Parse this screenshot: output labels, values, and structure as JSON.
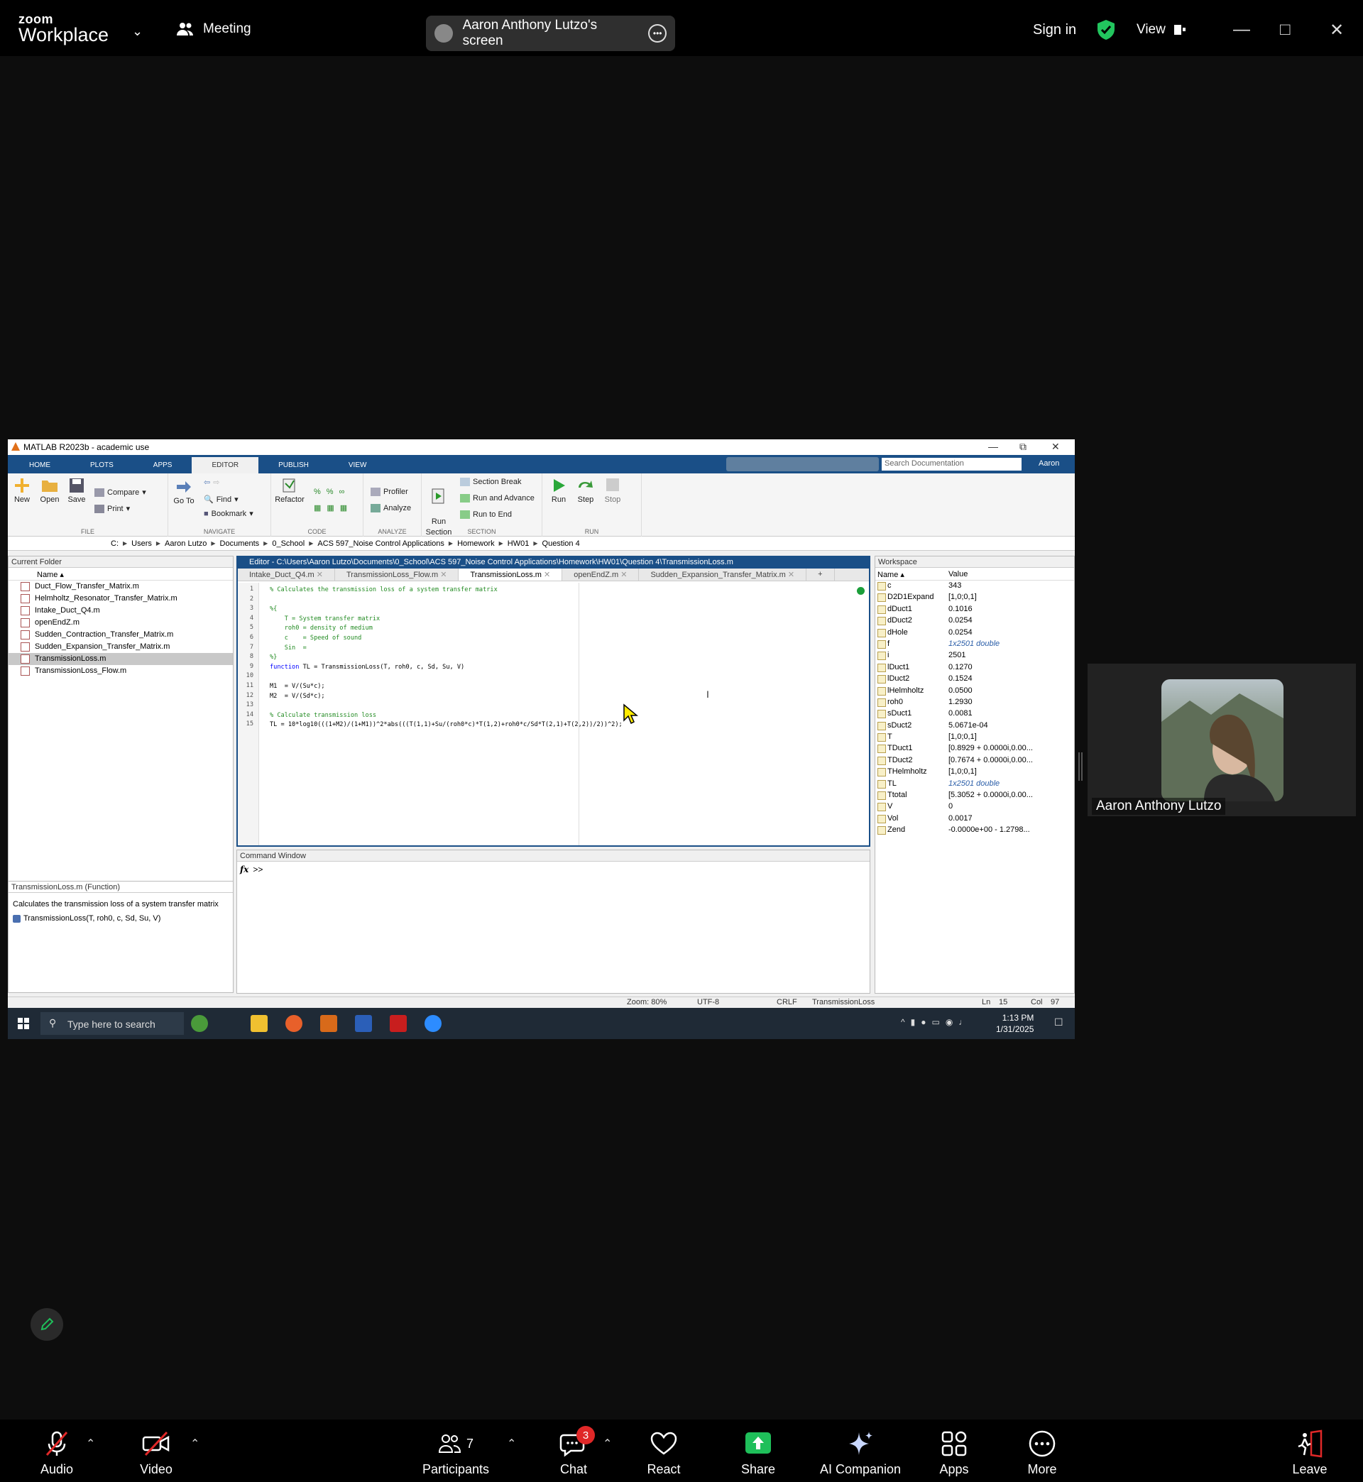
{
  "zoom": {
    "logo_small": "zoom",
    "logo_big": "Workplace",
    "meeting_label": "Meeting",
    "screen_label": "Aaron Anthony Lutzo's screen",
    "sign_in": "Sign in",
    "view_label": "View",
    "accent": "#0e72ed",
    "shield_color": "#22c55e"
  },
  "matlab": {
    "title": "MATLAB R2023b - academic use",
    "tabs": [
      "HOME",
      "PLOTS",
      "APPS",
      "EDITOR",
      "PUBLISH",
      "VIEW"
    ],
    "search_placeholder": "Search Documentation",
    "user": "Aaron",
    "ribbon": {
      "new": "New",
      "open": "Open",
      "save": "Save",
      "compare": "Compare",
      "print": "Print",
      "goto": "Go To",
      "find": "Find",
      "bookmark": "Bookmark",
      "refactor": "Refactor",
      "profiler": "Profiler",
      "analyze": "Analyze",
      "run_section": "Run\nSection",
      "section_break": "Section Break",
      "run_and_advance": "Run and Advance",
      "run_to_end": "Run to End",
      "run": "Run",
      "step": "Step",
      "stop": "Stop",
      "groups": [
        "FILE",
        "NAVIGATE",
        "CODE",
        "ANALYZE",
        "SECTION",
        "RUN"
      ]
    },
    "address": [
      "C:",
      "Users",
      "Aaron Lutzo",
      "Documents",
      "0_School",
      "ACS 597_Noise Control Applications",
      "Homework",
      "HW01",
      "Question 4"
    ],
    "current_folder": {
      "title": "Current Folder",
      "col_name": "Name",
      "files": [
        "Duct_Flow_Transfer_Matrix.m",
        "Helmholtz_Resonator_Transfer_Matrix.m",
        "Intake_Duct_Q4.m",
        "openEndZ.m",
        "Sudden_Contraction_Transfer_Matrix.m",
        "Sudden_Expansion_Transfer_Matrix.m",
        "TransmissionLoss.m",
        "TransmissionLoss_Flow.m"
      ],
      "selected_index": 6
    },
    "details": {
      "title": "TransmissionLoss.m  (Function)",
      "description": "Calculates the transmission loss of a system transfer matrix",
      "signature": "TransmissionLoss(T, roh0, c, Sd, Su, V)"
    },
    "editor": {
      "title": "Editor - C:\\Users\\Aaron Lutzo\\Documents\\0_School\\ACS 597_Noise Control Applications\\Homework\\HW01\\Question 4\\TransmissionLoss.m",
      "tabs": [
        "Intake_Duct_Q4.m",
        "TransmissionLoss_Flow.m",
        "TransmissionLoss.m",
        "openEndZ.m",
        "Sudden_Expansion_Transfer_Matrix.m",
        "+"
      ],
      "active_tab": 2,
      "lines": [
        {
          "n": "1",
          "t": "% Calculates the transmission loss of a system transfer matrix",
          "k": "com"
        },
        {
          "n": "2",
          "t": "",
          "k": "norm"
        },
        {
          "n": "3",
          "t": "%{",
          "k": "com"
        },
        {
          "n": "4",
          "t": "    T = System transfer matrix",
          "k": "com"
        },
        {
          "n": "5",
          "t": "    roh0 = density of medium",
          "k": "com"
        },
        {
          "n": "6",
          "t": "    c    = Speed of sound",
          "k": "com"
        },
        {
          "n": "7",
          "t": "    Sin  =",
          "k": "com"
        },
        {
          "n": "8",
          "t": "%}",
          "k": "com"
        },
        {
          "n": "9",
          "t": "function TL = TransmissionLoss(T, roh0, c, Sd, Su, V)",
          "k": "fn"
        },
        {
          "n": "10",
          "t": "",
          "k": "norm"
        },
        {
          "n": "11",
          "t": "M1  = V/(Su*c);",
          "k": "norm"
        },
        {
          "n": "12",
          "t": "M2  = V/(Sd*c);",
          "k": "norm"
        },
        {
          "n": "13",
          "t": "",
          "k": "norm"
        },
        {
          "n": "14",
          "t": "% Calculate transmission loss",
          "k": "com"
        },
        {
          "n": "15",
          "t": "TL = 10*log10(((1+M2)/(1+M1))^2*abs(((T(1,1)+Su/(roh0*c)*T(1,2)+roh0*c/Sd*T(2,1)+T(2,2))/2))^2);",
          "k": "norm"
        }
      ]
    },
    "command_window": {
      "title": "Command Window",
      "fx": "fx",
      "prompt": ">>"
    },
    "workspace": {
      "title": "Workspace",
      "col_name": "Name",
      "col_value": "Value",
      "vars": [
        {
          "name": "c",
          "value": "343"
        },
        {
          "name": "D2D1Expand",
          "value": "[1,0;0,1]"
        },
        {
          "name": "dDuct1",
          "value": "0.1016"
        },
        {
          "name": "dDuct2",
          "value": "0.0254"
        },
        {
          "name": "dHole",
          "value": "0.0254"
        },
        {
          "name": "f",
          "value": "1x2501 double",
          "italic": true
        },
        {
          "name": "i",
          "value": "2501"
        },
        {
          "name": "lDuct1",
          "value": "0.1270"
        },
        {
          "name": "lDuct2",
          "value": "0.1524"
        },
        {
          "name": "lHelmholtz",
          "value": "0.0500"
        },
        {
          "name": "roh0",
          "value": "1.2930"
        },
        {
          "name": "sDuct1",
          "value": "0.0081"
        },
        {
          "name": "sDuct2",
          "value": "5.0671e-04"
        },
        {
          "name": "T",
          "value": "[1,0;0,1]"
        },
        {
          "name": "TDuct1",
          "value": "[0.8929 + 0.0000i,0.00..."
        },
        {
          "name": "TDuct2",
          "value": "[0.7674 + 0.0000i,0.00..."
        },
        {
          "name": "THelmholtz",
          "value": "[1,0;0,1]"
        },
        {
          "name": "TL",
          "value": "1x2501 double",
          "italic": true
        },
        {
          "name": "Ttotal",
          "value": "[5.3052 + 0.0000i,0.00..."
        },
        {
          "name": "V",
          "value": "0"
        },
        {
          "name": "Vol",
          "value": "0.0017"
        },
        {
          "name": "Zend",
          "value": "-0.0000e+00 - 1.2798..."
        }
      ]
    },
    "status": {
      "zoom": "Zoom: 80%",
      "encoding": "UTF-8",
      "eol": "CRLF",
      "file": "TransmissionLoss",
      "ln": "Ln",
      "ln_val": "15",
      "col": "Col",
      "col_val": "97"
    }
  },
  "windows": {
    "search_placeholder": "Type here to search",
    "time": "1:13 PM",
    "date": "1/31/2025"
  },
  "participant": {
    "name": "Aaron Anthony Lutzo"
  },
  "toolbar": {
    "audio": "Audio",
    "video": "Video",
    "participants": "Participants",
    "participants_count": "7",
    "chat": "Chat",
    "chat_badge": "3",
    "react": "React",
    "share": "Share",
    "ai_companion": "AI Companion",
    "apps": "Apps",
    "more": "More",
    "leave": "Leave",
    "share_color": "#1fbf5a",
    "leave_color": "#e02828"
  }
}
